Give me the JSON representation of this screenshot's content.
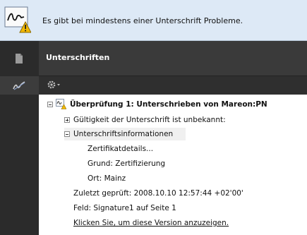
{
  "warning": {
    "message": "Es gibt bei mindestens einer Unterschrift Probleme."
  },
  "sidebar": {
    "items": [
      {
        "name": "pages-icon"
      },
      {
        "name": "signatures-icon"
      }
    ]
  },
  "panel": {
    "title": "Unterschriften"
  },
  "toolbar": {
    "options_icon": "gear-icon"
  },
  "signature": {
    "heading": "Überprüfung 1: Unterschrieben von Mareon:PN",
    "validity": "Gültigkeit der Unterschrift ist unbekannt:",
    "info_label": "Unterschriftsinformationen",
    "cert_details": "Zertifikatdetails...",
    "reason": "Grund: Zertifizierung",
    "location": "Ort: Mainz",
    "last_checked": "Zuletzt geprüft: 2008.10.10 12:57:44 +02'00'",
    "field": "Feld: Signature1 auf Seite 1",
    "view_version_link": "Klicken Sie, um diese Version anzuzeigen."
  },
  "colors": {
    "warning_bg": "#dde9f6",
    "dark_panel": "#3a3a3a",
    "sidebar": "#2b2b2b"
  }
}
